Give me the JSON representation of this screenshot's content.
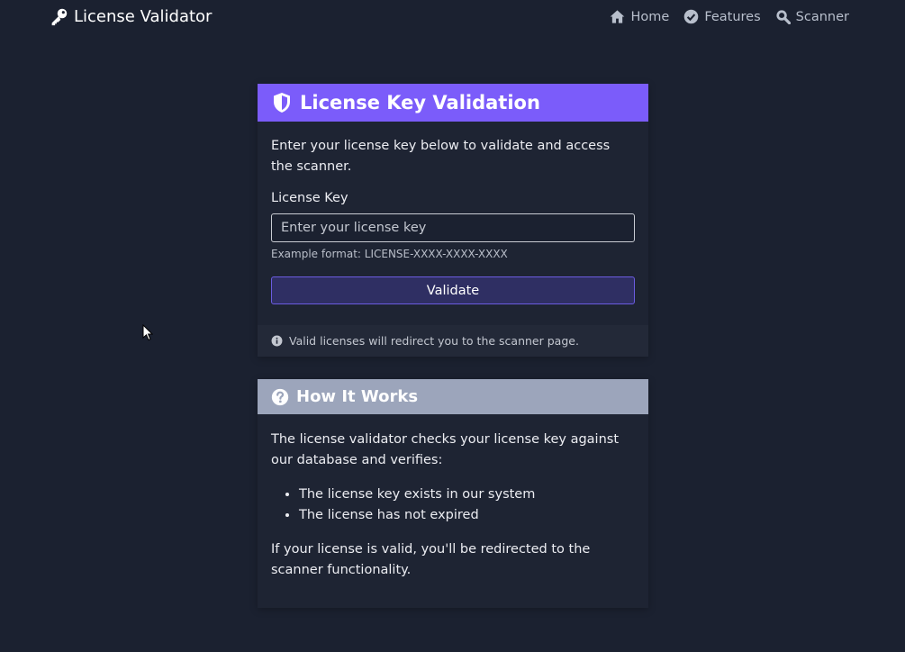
{
  "navbar": {
    "brand": "License Validator",
    "brand_icon": "key-icon",
    "links": [
      {
        "label": "Home",
        "icon": "home-icon"
      },
      {
        "label": "Features",
        "icon": "check-circle-icon"
      },
      {
        "label": "Scanner",
        "icon": "search-icon"
      }
    ]
  },
  "validation_card": {
    "title": "License Key Validation",
    "icon": "shield-icon",
    "intro": "Enter your license key below to validate and access the scanner.",
    "field_label": "License Key",
    "input_value": "",
    "input_placeholder": "Enter your license key",
    "hint": "Example format: LICENSE-XXXX-XXXX-XXXX",
    "button_label": "Validate",
    "footer_note": "Valid licenses will redirect you to the scanner page."
  },
  "how_card": {
    "title": "How It Works",
    "icon": "question-circle-icon",
    "intro": "The license validator checks your license key against our database and verifies:",
    "items": [
      "The license key exists in our system",
      "The license has not expired"
    ],
    "outro": "If your license is valid, you'll be redirected to the scanner functionality."
  },
  "colors": {
    "background": "#1b2130",
    "card": "#1e2433",
    "primary_header": "#7b5cfa",
    "secondary_header": "#9ca5bb",
    "button": "#2f2f63"
  }
}
